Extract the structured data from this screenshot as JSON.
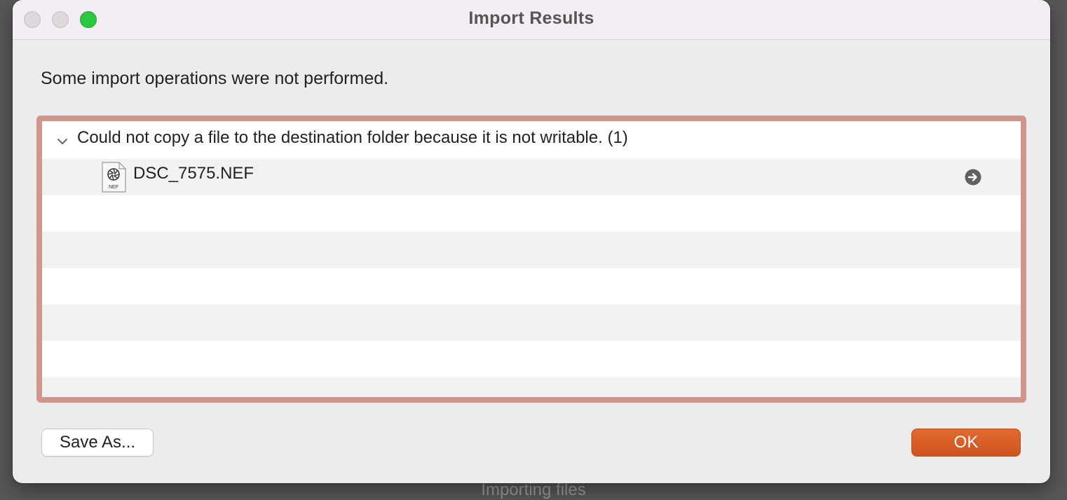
{
  "background": {
    "status_text": "Importing files"
  },
  "window": {
    "title": "Import Results",
    "traffic_lights": [
      "close",
      "minimize",
      "zoom"
    ]
  },
  "message": "Some import operations were not performed.",
  "issues": [
    {
      "expanded": true,
      "label": "Could not copy a file to the destination folder because it is not writable. (1)",
      "files": [
        {
          "name": "DSC_7575.NEF",
          "icon": "nef-file-icon",
          "icon_badge": "NEF",
          "action_icon": "reveal-arrow-icon"
        }
      ]
    }
  ],
  "buttons": {
    "save_as": "Save As...",
    "ok": "OK"
  },
  "colors": {
    "accent": "#d85c25",
    "list_border": "#d0968c",
    "zoom_button": "#2ac840"
  }
}
